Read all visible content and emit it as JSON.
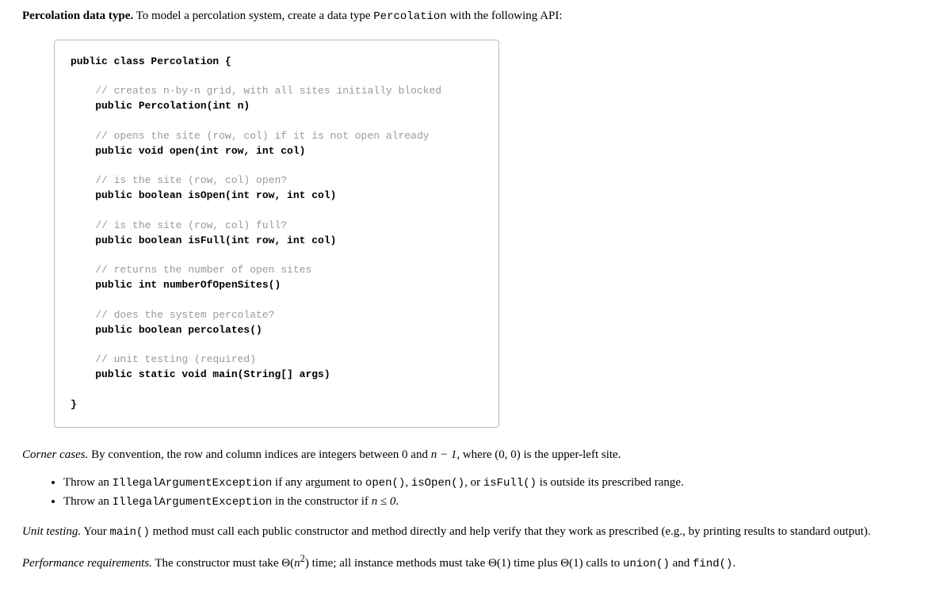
{
  "header": {
    "title_bold": "Percolation data type.",
    "title_rest": " To model a percolation system, create a data type ",
    "title_code": "Percolation",
    "title_tail": " with the following API:"
  },
  "code": {
    "open": "public class Percolation {",
    "c1": "    // creates n-by-n grid, with all sites initially blocked",
    "s1": "    public Percolation(int n)",
    "c2": "    // opens the site (row, col) if it is not open already",
    "s2": "    public void open(int row, int col)",
    "c3": "    // is the site (row, col) open?",
    "s3": "    public boolean isOpen(int row, int col)",
    "c4": "    // is the site (row, col) full?",
    "s4": "    public boolean isFull(int row, int col)",
    "c5": "    // returns the number of open sites",
    "s5": "    public int numberOfOpenSites()",
    "c6": "    // does the system percolate?",
    "s6": "    public boolean percolates()",
    "c7": "    // unit testing (required)",
    "s7": "    public static void main(String[] args)",
    "close": "}"
  },
  "corner": {
    "label": "Corner cases.",
    "text_a": "  By convention, the row and column indices are integers between 0 and ",
    "text_n1": "n − 1",
    "text_b": ", where (0, 0) is the upper-left site."
  },
  "bullets": {
    "b1_a": "Throw an ",
    "b1_code1": "IllegalArgumentException",
    "b1_b": " if any argument to ",
    "b1_code2": "open()",
    "b1_c": ", ",
    "b1_code3": "isOpen()",
    "b1_d": ", or ",
    "b1_code4": "isFull()",
    "b1_e": " is outside its prescribed range.",
    "b2_a": "Throw an ",
    "b2_code1": "IllegalArgumentException",
    "b2_b": " in the constructor if ",
    "b2_n": "n ≤ 0",
    "b2_c": "."
  },
  "unit": {
    "label": "Unit testing.",
    "text_a": "  Your ",
    "code1": "main()",
    "text_b": " method must call each public constructor and method directly and help verify that they work as prescribed (e.g., by printing results to standard output)."
  },
  "perf": {
    "label": "Performance requirements.",
    "text_a": "  The constructor must take Θ(",
    "n2": "n",
    "sup2": "2",
    "text_b": ") time; all instance methods must take Θ(1) time plus Θ(1) calls to ",
    "code1": "union()",
    "text_c": " and ",
    "code2": "find()",
    "text_d": "."
  }
}
